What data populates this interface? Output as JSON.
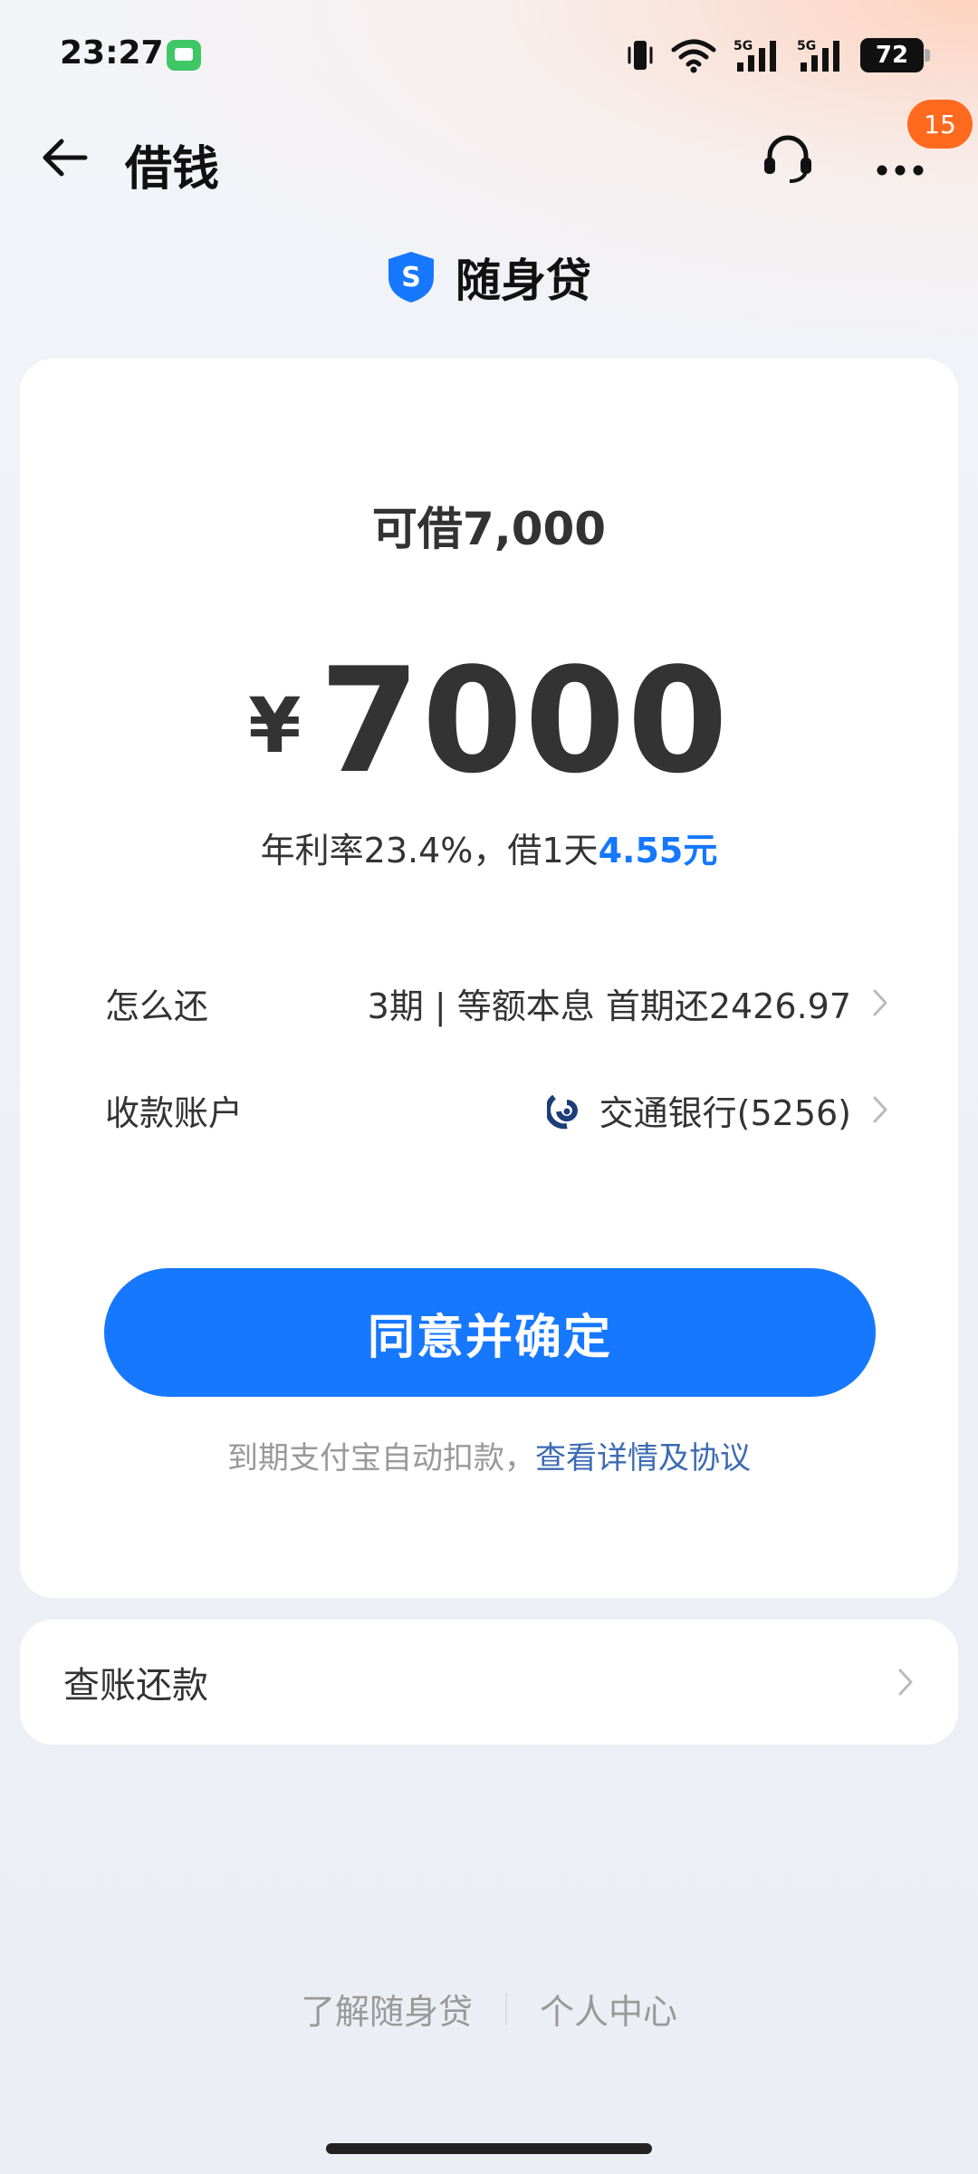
{
  "status_bar": {
    "time": "23:27",
    "battery": "72",
    "signal_label_1": "5G",
    "signal_label_2": "5G"
  },
  "nav": {
    "title": "借钱",
    "badge_count": "15"
  },
  "brand": {
    "name": "随身贷",
    "logo_letter": "S"
  },
  "loan": {
    "available_label": "可借7,000",
    "currency": "¥",
    "amount": "7000",
    "rate_text": "年利率23.4%，借1天",
    "rate_highlight": "4.55元"
  },
  "repay": {
    "label": "怎么还",
    "value": "3期 | 等额本息 首期还2426.97"
  },
  "account": {
    "label": "收款账户",
    "value": "交通银行(5256)"
  },
  "cta": {
    "label": "同意并确定"
  },
  "terms": {
    "text": "到期支付宝自动扣款，",
    "link": "查看详情及协议"
  },
  "bill": {
    "label": "查账还款"
  },
  "footer": {
    "link1": "了解随身贷",
    "link2": "个人中心"
  },
  "colors": {
    "primary": "#1677ff",
    "badge": "#ff6a1f"
  }
}
